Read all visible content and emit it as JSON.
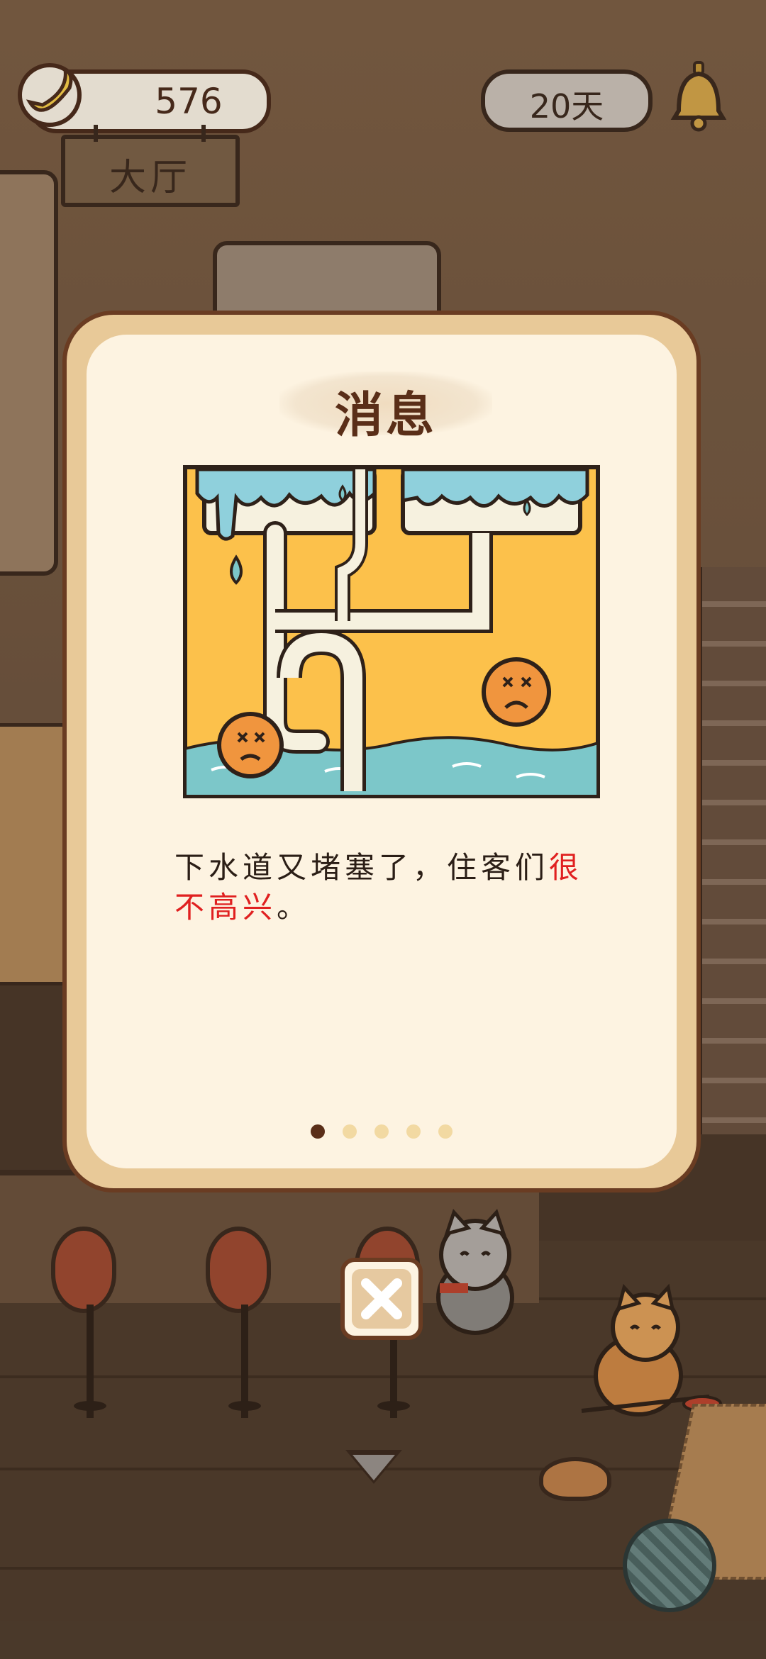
{
  "hud": {
    "coins": "576",
    "days": "20天",
    "room_sign": "大厅"
  },
  "modal": {
    "title": "消息",
    "message_normal": "下水道又堵塞了，住客们",
    "message_highlight": "很不高兴",
    "message_end": "。",
    "page_count": 5,
    "active_page": 1
  },
  "colors": {
    "highlight": "#e02020",
    "panel_border": "#6a3c22",
    "panel_bg": "#fdf3e1",
    "accent_yellow": "#fcc14b",
    "water_blue": "#7cc7c9"
  },
  "icons": {
    "coin": "banana-coin-icon",
    "bell": "bell-icon",
    "close": "close-icon",
    "down": "chevron-down-icon",
    "yarn": "yarn-ball-icon"
  }
}
